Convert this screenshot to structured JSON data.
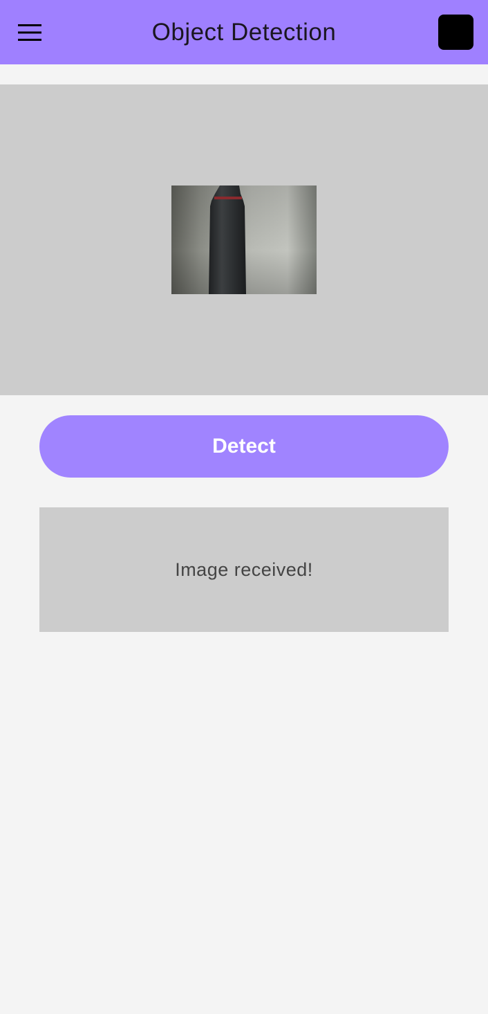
{
  "app_bar": {
    "title": "Object Detection",
    "background_color": "#9f80ff",
    "menu_icon": "hamburger-menu-icon",
    "action_icon": "black-square-icon"
  },
  "image_panel": {
    "background_color": "#cccccc",
    "image_description": "camera-photo-of-dark-bottle"
  },
  "detect_button": {
    "label": "Detect",
    "color": "#a084ff"
  },
  "result": {
    "message": "Image received!",
    "background_color": "#cccccc"
  }
}
